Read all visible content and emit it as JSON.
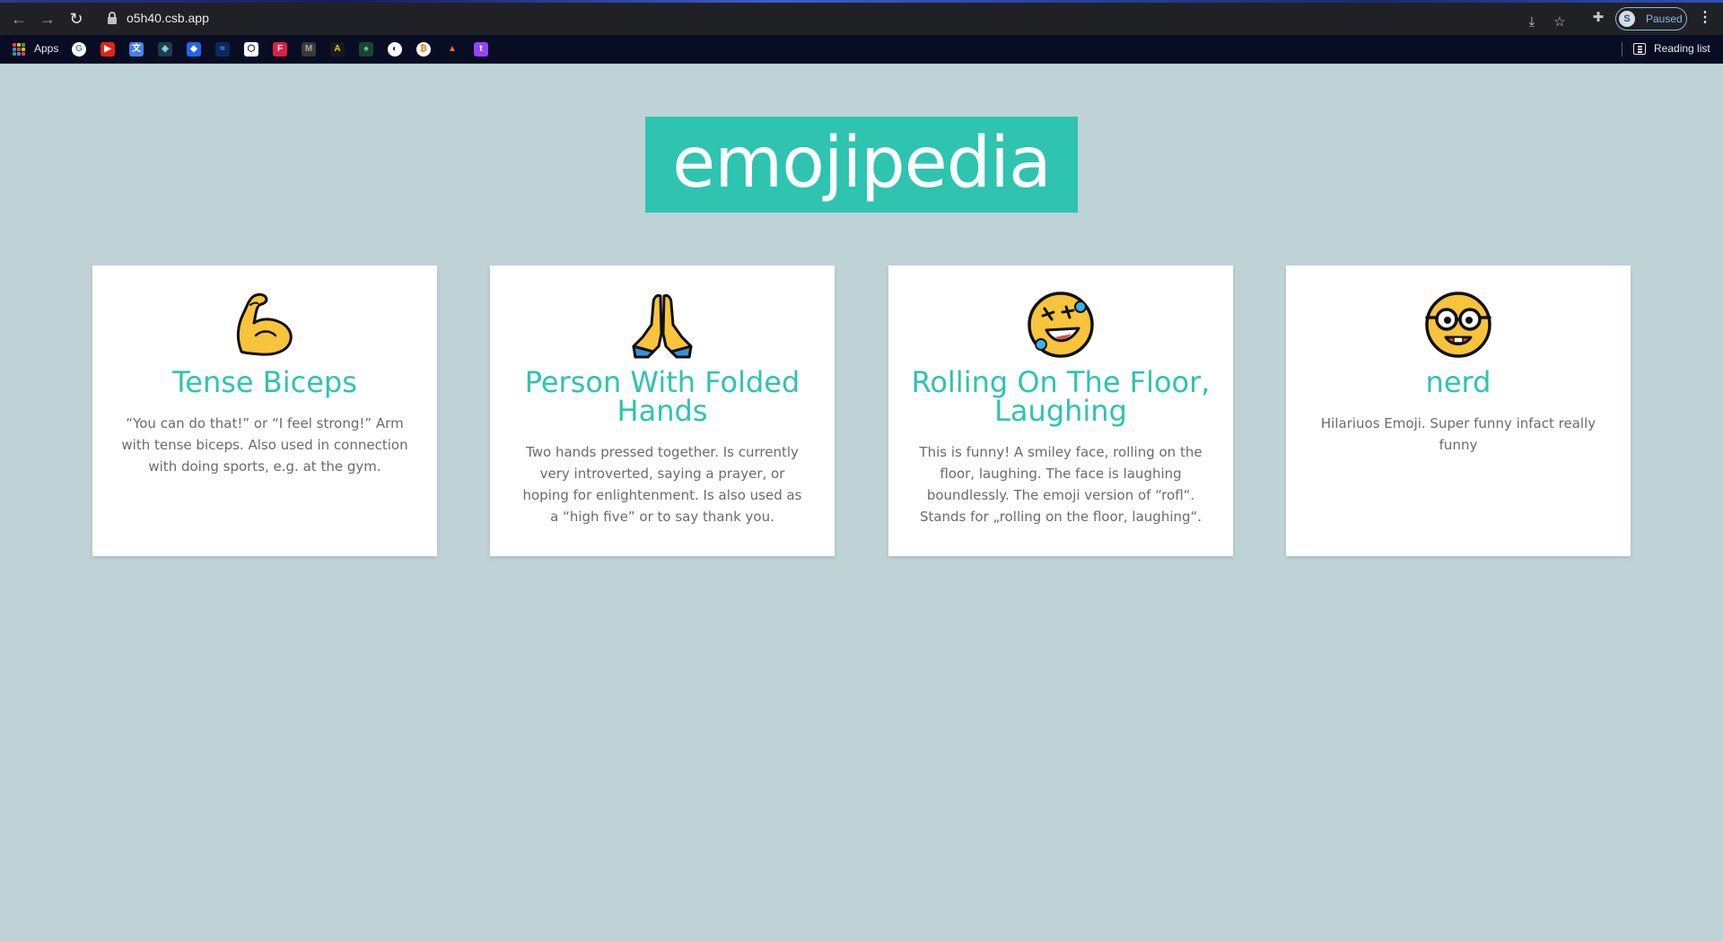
{
  "browser": {
    "url": "o5h40.csb.app",
    "profile_status": "Paused",
    "profile_initial": "S",
    "apps_label": "Apps",
    "reading_list_label": "Reading list"
  },
  "page": {
    "logo": "emojipedia"
  },
  "cards": [
    {
      "emoji": "flexed-biceps",
      "title": "Tense Biceps",
      "description": "“You can do that!” or “I feel strong!” Arm with tense biceps. Also used in connection with doing sports, e.g. at the gym."
    },
    {
      "emoji": "folded-hands",
      "title": "Person With Folded Hands",
      "description": "Two hands pressed together. Is currently very introverted, saying a prayer, or hoping for enlightenment. Is also used as a “high five” or to say thank you."
    },
    {
      "emoji": "rolling-on-the-floor-laughing",
      "title": "Rolling On The Floor, Laughing",
      "description": "This is funny! A smiley face, rolling on the floor, laughing. The face is laughing boundlessly. The emoji version of “rofl“. Stands for „rolling on the floor, laughing“."
    },
    {
      "emoji": "nerd-face",
      "title": "nerd",
      "description": "Hilariuos Emoji. Super funny infact really funny"
    }
  ]
}
